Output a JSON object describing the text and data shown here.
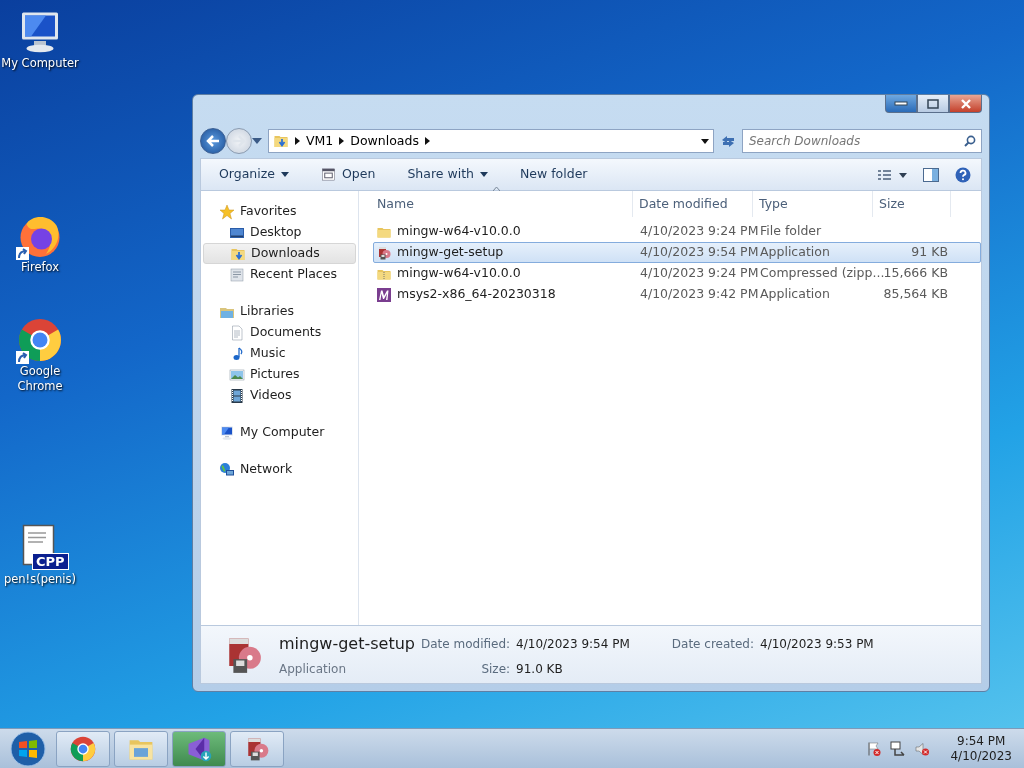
{
  "desktop_icons": [
    {
      "label": "My Computer",
      "kind": "computer",
      "shortcut": false
    },
    {
      "label": "Firefox",
      "kind": "firefox",
      "shortcut": true
    },
    {
      "label": "Google Chrome",
      "kind": "chrome",
      "shortcut": true
    },
    {
      "label": "pen!s(penis)",
      "kind": "cpp",
      "shortcut": false,
      "badge": "CPP"
    }
  ],
  "window": {
    "breadcrumb": [
      "VM1",
      "Downloads"
    ],
    "search": {
      "placeholder": "Search Downloads"
    },
    "toolbar": [
      {
        "label": "Organize",
        "kind": "plain",
        "dropdown": true
      },
      {
        "label": "Open",
        "kind": "open",
        "dropdown": false
      },
      {
        "label": "Share with",
        "kind": "plain",
        "dropdown": true
      },
      {
        "label": "New folder",
        "kind": "plain",
        "dropdown": false
      }
    ],
    "sidebar": [
      {
        "label": "Favorites",
        "kind": "star",
        "selected": false,
        "children": [
          {
            "label": "Desktop",
            "kind": "desktop",
            "selected": false
          },
          {
            "label": "Downloads",
            "kind": "downloads",
            "selected": true
          },
          {
            "label": "Recent Places",
            "kind": "recent",
            "selected": false
          }
        ]
      },
      {
        "label": "Libraries",
        "kind": "library",
        "selected": false,
        "children": [
          {
            "label": "Documents",
            "kind": "document",
            "selected": false
          },
          {
            "label": "Music",
            "kind": "music",
            "selected": false
          },
          {
            "label": "Pictures",
            "kind": "pictures",
            "selected": false
          },
          {
            "label": "Videos",
            "kind": "video",
            "selected": false
          }
        ]
      },
      {
        "label": "My Computer",
        "kind": "computer",
        "selected": false
      },
      {
        "label": "Network",
        "kind": "network",
        "selected": false
      }
    ],
    "columns": [
      "Name",
      "Date modified",
      "Type",
      "Size"
    ],
    "rows": [
      {
        "name": "mingw-w64-v10.0.0",
        "date": "4/10/2023 9:24 PM",
        "type": "File folder",
        "size": "",
        "kind": "folder",
        "selected": false
      },
      {
        "name": "mingw-get-setup",
        "date": "4/10/2023 9:54 PM",
        "type": "Application",
        "size": "91 KB",
        "kind": "setup",
        "selected": true
      },
      {
        "name": "mingw-w64-v10.0.0",
        "date": "4/10/2023 9:24 PM",
        "type": "Compressed (zipp...",
        "size": "15,666 KB",
        "kind": "zip",
        "selected": false
      },
      {
        "name": "msys2-x86_64-20230318",
        "date": "4/10/2023 9:42 PM",
        "type": "Application",
        "size": "85,564 KB",
        "kind": "msys",
        "selected": false
      }
    ],
    "details": {
      "name": "mingw-get-setup",
      "type": "Application",
      "fields": [
        {
          "label": "Date modified:",
          "value": "4/10/2023 9:54 PM"
        },
        {
          "label": "Size:",
          "value": "91.0 KB"
        },
        {
          "label": "Date created:",
          "value": "4/10/2023 9:53 PM"
        }
      ]
    }
  },
  "taskbar": {
    "apps": [
      {
        "kind": "chrome"
      },
      {
        "kind": "explorer"
      },
      {
        "kind": "vs"
      },
      {
        "kind": "setup"
      }
    ],
    "tray": [
      {
        "kind": "flag"
      },
      {
        "kind": "network"
      },
      {
        "kind": "volume"
      }
    ],
    "time": "9:54 PM",
    "date": "4/10/2023"
  }
}
